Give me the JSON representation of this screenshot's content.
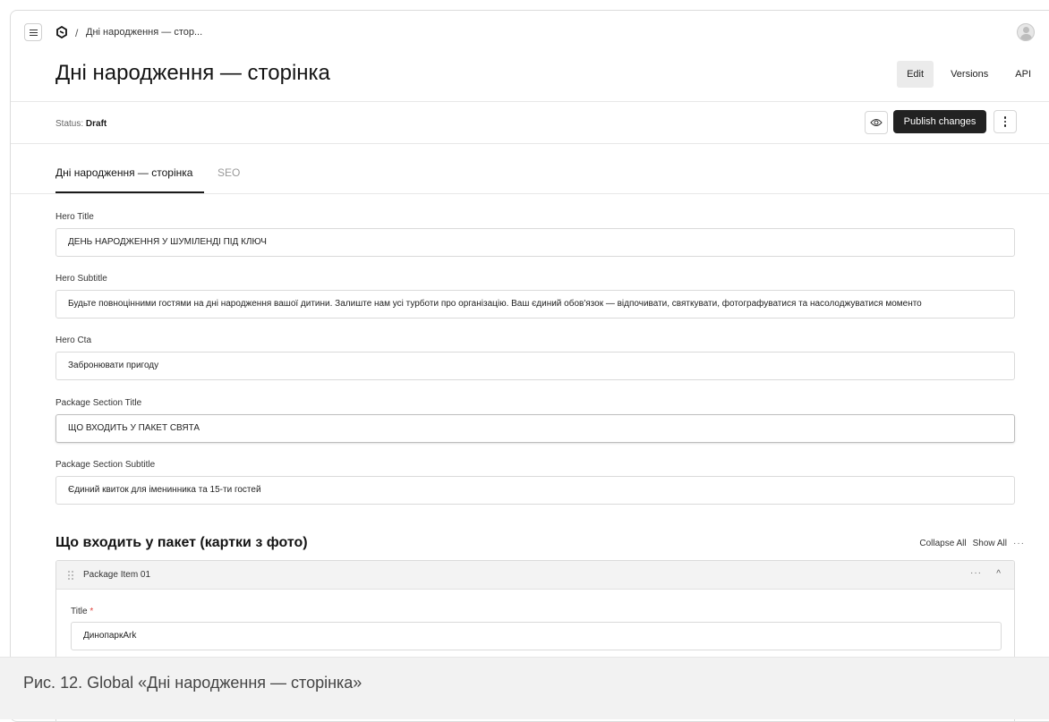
{
  "breadcrumb": {
    "separator": "/",
    "current": "Дні народження — стор..."
  },
  "header": {
    "title": "Дні народження — сторінка",
    "view_tabs": [
      "Edit",
      "Versions",
      "API"
    ]
  },
  "status": {
    "label": "Status:",
    "value": "Draft",
    "publish_label": "Publish changes"
  },
  "content_tabs": [
    "Дні народження — сторінка",
    "SEO"
  ],
  "fields": [
    {
      "label": "Hero Title",
      "value": "ДЕНЬ НАРОДЖЕННЯ У ШУМІЛЕНДІ ПІД КЛЮЧ"
    },
    {
      "label": "Hero Subtitle",
      "value": "Будьте повноцінними гостями на дні народження вашої дитини. Залиште нам усі турботи про організацію. Ваш єдиний обов'язок — відпочивати, святкувати, фотографуватися та насолоджуватися моменто"
    },
    {
      "label": "Hero Cta",
      "value": "Забронювати пригоду"
    },
    {
      "label": "Package Section Title",
      "value": "ЩО ВХОДИТЬ У ПАКЕТ СВЯТА"
    },
    {
      "label": "Package Section Subtitle",
      "value": "Єдиний квиток для іменинника та 15-ти гостей"
    }
  ],
  "section": {
    "title": "Що входить у пакет (картки з фото)",
    "collapse_all": "Collapse All",
    "show_all": "Show All",
    "more": "···"
  },
  "item": {
    "title": "Package Item 01",
    "more": "···",
    "chevron": "^",
    "field_label": "Title",
    "required_mark": "*",
    "field_value": "ДинопаркArk"
  },
  "caption": "Рис. 12. Global «Дні народження — сторінка»"
}
